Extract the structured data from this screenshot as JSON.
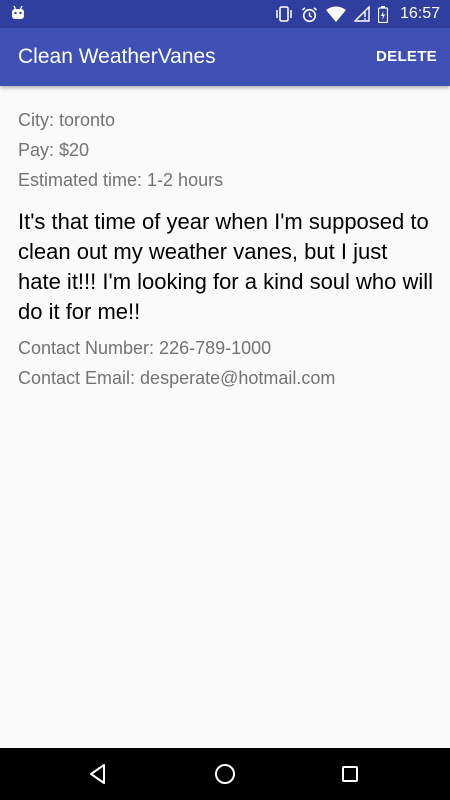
{
  "status_bar": {
    "time": "16:57",
    "icons": [
      "android-icon",
      "vibrate-icon",
      "alarm-icon",
      "wifi-icon",
      "no-sim-icon",
      "battery-icon"
    ]
  },
  "app_bar": {
    "title": "Clean WeatherVanes",
    "delete_label": "DELETE"
  },
  "job": {
    "city": "City: toronto",
    "pay": "Pay: $20",
    "estimated_time": "Estimated time: 1-2 hours",
    "description": "It's that time of year when I'm supposed to clean out my weather vanes, but I just hate it!!! I'm looking for a kind soul who will do it for me!!",
    "contact_number": "Contact Number: 226-789-1000",
    "contact_email": "Contact Email: desperate@hotmail.com"
  },
  "nav_bar": {
    "buttons": [
      "back-icon",
      "home-icon",
      "recents-icon"
    ]
  },
  "colors": {
    "status_bar": "#303f9f",
    "app_bar": "#3f51b5",
    "background": "#fafafa",
    "secondary_text": "#737373",
    "primary_text": "#000000"
  }
}
